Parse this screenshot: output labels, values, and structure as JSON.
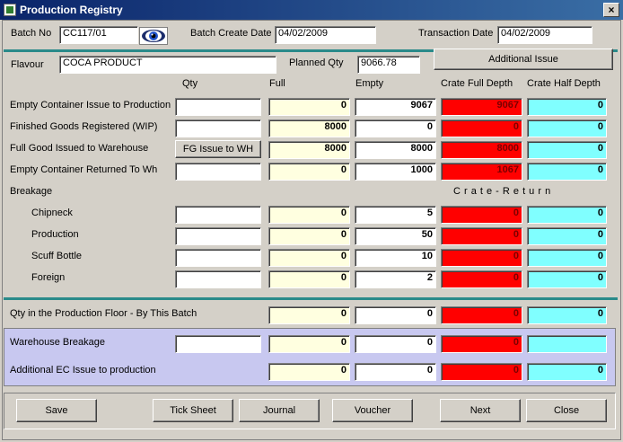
{
  "window": {
    "title": "Production Registry",
    "close_glyph": "×"
  },
  "header": {
    "batch_no_label": "Batch No",
    "batch_no_value": "CC117/01",
    "batch_create_date_label": "Batch Create Date",
    "batch_create_date_value": "04/02/2009",
    "transaction_date_label": "Transaction Date",
    "transaction_date_value": "04/02/2009",
    "flavour_label": "Flavour",
    "flavour_value": "COCA PRODUCT",
    "planned_qty_label": "Planned Qty",
    "planned_qty_value": "9066.78",
    "additional_issue_label": "Additional Issue"
  },
  "columns": {
    "qty": "Qty",
    "full": "Full",
    "empty": "Empty",
    "crate_full_depth": "Crate Full Depth",
    "crate_half_depth": "Crate Half Depth"
  },
  "rows": [
    {
      "label": "Empty Container Issue to Production",
      "qty": "",
      "full": "0",
      "empty": "9067",
      "crate_full": "9067",
      "crate_half": "0"
    },
    {
      "label": "Finished Goods Registered  (WIP)",
      "qty": "",
      "full": "8000",
      "empty": "0",
      "crate_full": "0",
      "crate_half": "0"
    },
    {
      "label": "Full Good Issued to Warehouse",
      "qty_button": "FG Issue to WH",
      "full": "8000",
      "empty": "8000",
      "crate_full": "8000",
      "crate_half": "0"
    },
    {
      "label": "Empty Container Returned To Wh",
      "qty": "",
      "full": "0",
      "empty": "1000",
      "crate_full": "1067",
      "crate_half": "0"
    }
  ],
  "breakage": {
    "label": "Breakage",
    "crate_return_label": "C r a t e  -  R e t u r n",
    "rows": [
      {
        "label": "Chipneck",
        "qty": "",
        "full": "0",
        "empty": "5",
        "crate_full": "0",
        "crate_half": "0"
      },
      {
        "label": "Production",
        "qty": "",
        "full": "0",
        "empty": "50",
        "crate_full": "0",
        "crate_half": "0"
      },
      {
        "label": "Scuff Bottle",
        "qty": "",
        "full": "0",
        "empty": "10",
        "crate_full": "0",
        "crate_half": "0"
      },
      {
        "label": "Foreign",
        "qty": "",
        "full": "0",
        "empty": "2",
        "crate_full": "0",
        "crate_half": "0"
      }
    ]
  },
  "floor": {
    "label": "Qty in the Production Floor - By This Batch",
    "full": "0",
    "empty": "0",
    "crate_full": "0",
    "crate_half": "0"
  },
  "warehouse_breakage": {
    "label": "Warehouse Breakage",
    "qty": "",
    "full": "0",
    "empty": "0",
    "crate_full": "0",
    "crate_half": ""
  },
  "additional_ec": {
    "label": "Additional EC Issue to production",
    "full": "0",
    "empty": "0",
    "crate_full": "0",
    "crate_half": "0"
  },
  "buttons": {
    "save": "Save",
    "tick_sheet": "Tick Sheet",
    "journal": "Journal",
    "voucher": "Voucher",
    "next": "Next",
    "close": "Close"
  },
  "colors": {
    "full_cell": "#ffffe0",
    "crate_full_cell": "#ff0000",
    "crate_half_cell": "#80ffff",
    "separator": "#2a8a8a",
    "bottom_panel": "#c8c8f0"
  },
  "icons": {
    "batch_lookup": "eye-icon"
  }
}
